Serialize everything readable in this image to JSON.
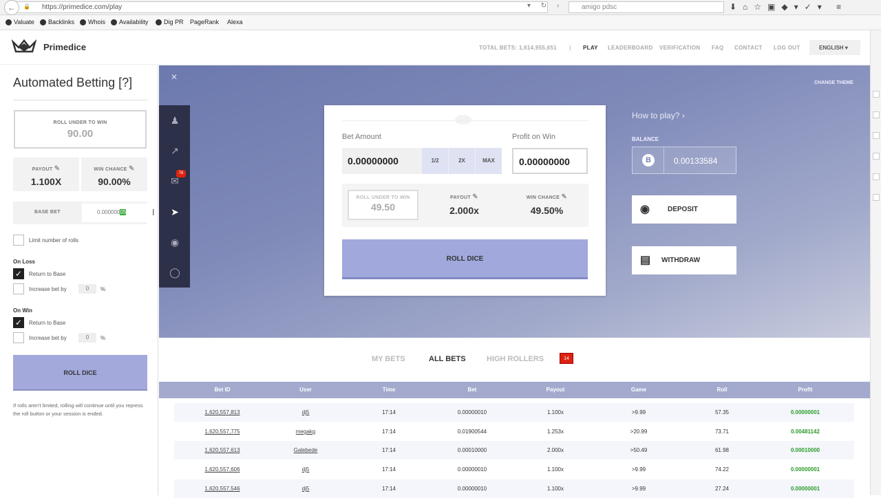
{
  "browser": {
    "url": "https://primedice.com/play",
    "search_text": "amigo pdsc"
  },
  "bookmarks": [
    "Valuate",
    "Backlinks",
    "Whois",
    "Availability",
    "Dig PR",
    "PageRank",
    "Alexa"
  ],
  "header": {
    "brand": "Primedice",
    "total_bets": "TOTAL BETS: 1,614,955,651",
    "nav": [
      "PLAY",
      "LEADERBOARD",
      "VERIFICATION",
      "FAQ",
      "CONTACT",
      "LOG OUT"
    ],
    "language": "ENGLISH"
  },
  "sidebar": {
    "title": "Automated Betting [?]",
    "roll_under_label": "ROLL UNDER TO WIN",
    "roll_under_value": "90.00",
    "payout_label": "PAYOUT",
    "payout_value": "1.100X",
    "win_chance_label": "WIN CHANCE",
    "win_chance_value": "90.00%",
    "base_bet_label": "BASE BET",
    "base_bet_value": "0.000000",
    "base_bet_selected": "05",
    "limit_rolls": "Limit number of rolls",
    "on_loss": "On Loss",
    "on_win": "On Win",
    "return_to_base": "Return to Base",
    "increase_bet_by": "Increase bet by",
    "increase_value": "0",
    "percent": "%",
    "roll_button": "ROLL DICE",
    "note": "If rolls aren't limited, rolling will continue until you repress the roll button or your session is ended."
  },
  "game": {
    "change_theme": "CHANGE THEME",
    "bet_amount_label": "Bet Amount",
    "bet_amount": "0.00000000",
    "multipliers": [
      "1/2",
      "2X",
      "MAX"
    ],
    "profit_label": "Profit on Win",
    "profit_value": "0.00000000",
    "roll_under_label": "ROLL UNDER TO WIN",
    "roll_under_value": "49.50",
    "payout_label": "PAYOUT",
    "payout_value": "2.000x",
    "win_chance_label": "WIN CHANCE",
    "win_chance_value": "49.50%",
    "roll_button": "ROLL DICE",
    "how_to_play": "How to play?",
    "balance_label": "BALANCE",
    "balance_value": "0.00133584",
    "deposit": "DEPOSIT",
    "withdraw": "WITHDRAW",
    "chat_badge": "76"
  },
  "bets": {
    "tabs": [
      "MY BETS",
      "ALL BETS",
      "HIGH ROLLERS"
    ],
    "high_rollers_badge": "14",
    "columns": [
      "Bet ID",
      "User",
      "Time",
      "Bet",
      "Payout",
      "Game",
      "Roll",
      "Profit"
    ],
    "rows": [
      [
        "1,620,557,813",
        "dj5",
        "17:14",
        "0.00000010",
        "1.100x",
        ">9.99",
        "57.35",
        "0.00000001"
      ],
      [
        "1,620,557,775",
        "megakg",
        "17:14",
        "0.01900544",
        "1.253x",
        ">20.99",
        "73.71",
        "0.00481142"
      ],
      [
        "1,620,557,613",
        "Galebede",
        "17:14",
        "0.00010000",
        "2.000x",
        ">50.49",
        "61.98",
        "0.00010000"
      ],
      [
        "1,620,557,606",
        "dj5",
        "17:14",
        "0.00000010",
        "1.100x",
        ">9.99",
        "74.22",
        "0.00000001"
      ],
      [
        "1,620,557,546",
        "dj5",
        "17:14",
        "0.00000010",
        "1.100x",
        ">9.99",
        "27.24",
        "0.00000001"
      ]
    ]
  },
  "colors": {
    "accent": "#a0a8dc",
    "iconbar": "#2c3048",
    "profit_green": "#2a9a2a",
    "badge_red": "#d21"
  }
}
